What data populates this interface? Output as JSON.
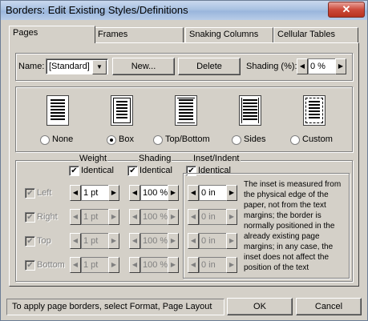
{
  "window": {
    "title": "Borders: Edit Existing Styles/Definitions",
    "close_glyph": "✕"
  },
  "tabs": [
    {
      "label": "Pages"
    },
    {
      "label": "Frames"
    },
    {
      "label": "Snaking Columns"
    },
    {
      "label": "Cellular Tables"
    }
  ],
  "style_row": {
    "name_label": "Name:",
    "name_value": "[Standard]",
    "new_label": "New...",
    "delete_label": "Delete",
    "shading_label": "Shading (%):",
    "shading_value": "0 %"
  },
  "border_types": [
    {
      "label": "None",
      "selected": false
    },
    {
      "label": "Box",
      "selected": true
    },
    {
      "label": "Top/Bottom",
      "selected": false
    },
    {
      "label": "Sides",
      "selected": false
    },
    {
      "label": "Custom",
      "selected": false
    }
  ],
  "columns": {
    "weight": "Weight",
    "shading": "Shading",
    "inset": "Inset/Indent",
    "identical": "Identical"
  },
  "rows": [
    {
      "label": "Left",
      "weight": "1 pt",
      "shading": "100 %",
      "inset": "0 in",
      "enabled": true
    },
    {
      "label": "Right",
      "weight": "1 pt",
      "shading": "100 %",
      "inset": "0 in",
      "enabled": false
    },
    {
      "label": "Top",
      "weight": "1 pt",
      "shading": "100 %",
      "inset": "0 in",
      "enabled": false
    },
    {
      "label": "Bottom",
      "weight": "1 pt",
      "shading": "100 %",
      "inset": "0 in",
      "enabled": false
    }
  ],
  "info_text": "The inset is measured from the physical edge of the paper, not from the text margins; the border is normally positioned in the already existing page margins; in any case, the inset does not affect the position of the text",
  "status_text": "To apply page borders, select Format, Page Layout",
  "buttons": {
    "ok": "OK",
    "cancel": "Cancel"
  },
  "colors": {
    "titlebar": "#a9c2e2",
    "dialog_bg": "#d4d0c8",
    "close_button": "#cc4a3b"
  }
}
